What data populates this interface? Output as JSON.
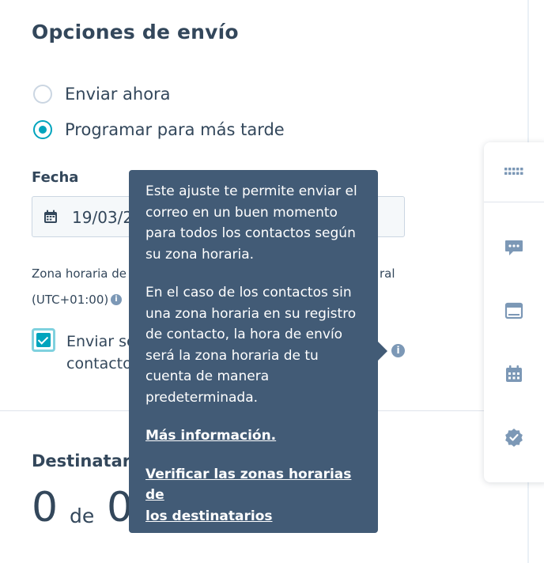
{
  "section": {
    "title": "Opciones de envío"
  },
  "send_options": [
    {
      "label": "Enviar ahora",
      "selected": false
    },
    {
      "label": "Programar para más tarde",
      "selected": true
    }
  ],
  "date_field": {
    "label": "Fecha",
    "value": "19/03/2"
  },
  "timezone": {
    "line1_left": "Zona horaria de",
    "line1_right": "ral",
    "line2": "(UTC+01:00)"
  },
  "recipient_tz_checkbox": {
    "checked": true,
    "line1": "Enviar se",
    "line2": "contacto"
  },
  "recipients": {
    "label": "Destinatari",
    "count": "0",
    "of": "de",
    "total": "0"
  },
  "tooltip": {
    "paragraph1": [
      "Este ajuste te permite enviar el",
      "correo en un buen momento",
      "para todos los contactos según",
      "su zona horaria."
    ],
    "paragraph2": [
      "En el caso de los contactos sin",
      "una zona horaria en su registro",
      "de contacto, la hora de envío",
      "será la zona horaria de tu",
      "cuenta de manera",
      "predeterminada."
    ],
    "link_more": "Más información.",
    "link_verify": [
      "Verificar las zonas horarias de",
      "los destinatarios"
    ]
  },
  "side_panel": {
    "icons": [
      "apps-grid-icon",
      "chat-bubble-icon",
      "browser-window-icon",
      "calendar-icon",
      "verified-badge-icon"
    ]
  },
  "colors": {
    "accent": "#00a4bd",
    "text": "#33475b",
    "tooltip_bg": "#425b76",
    "icon_gray": "#7c98b6"
  }
}
